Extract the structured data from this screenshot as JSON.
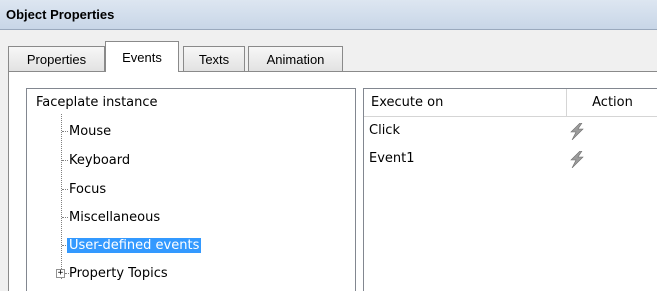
{
  "window": {
    "title": "Object Properties"
  },
  "tabs": [
    "Properties",
    "Events",
    "Texts",
    "Animation"
  ],
  "active_tab": "Events",
  "tree": {
    "root": "Faceplate instance",
    "items": [
      "Mouse",
      "Keyboard",
      "Focus",
      "Miscellaneous",
      "User-defined events",
      "Property Topics"
    ],
    "selected": "User-defined events",
    "expandable": [
      "Property Topics"
    ]
  },
  "grid": {
    "columns": [
      "Execute on",
      "Action"
    ],
    "rows": [
      {
        "execute_on": "Click",
        "action_icon": "lightning-icon"
      },
      {
        "execute_on": "Event1",
        "action_icon": "lightning-icon"
      }
    ]
  },
  "colors": {
    "selection": "#3399ff",
    "titlebar": "#c8d6e7"
  }
}
